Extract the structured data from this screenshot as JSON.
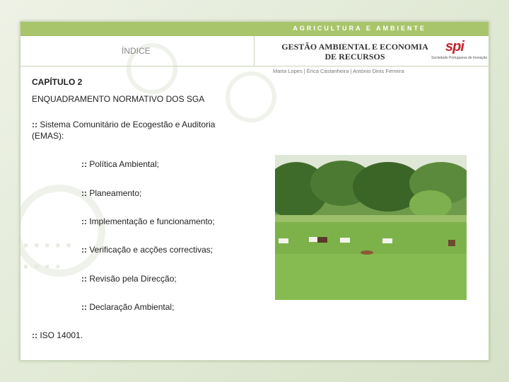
{
  "header": {
    "topbar_text": "AGRICULTURA E AMBIENTE",
    "index_label": "ÍNDICE",
    "book_title_line1": "GESTÃO AMBIENTAL E ECONOMIA",
    "book_title_line2": "DE RECURSOS",
    "logo_mark": "spi",
    "logo_text": "Sociedade Portuguesa de Inovação",
    "authors": "Marta Lopes | Érica Castanheira | António Dinis Ferreira"
  },
  "content": {
    "chapter": "CAPÍTULO 2",
    "subtitle": "ENQUADRAMENTO NORMATIVO DOS SGA",
    "bullet": "::",
    "emas_line1": "Sistema Comunitário de Ecogestão e Auditoria",
    "emas_line2": "(EMAS):",
    "sub_items": [
      "Política Ambiental;",
      "Planeamento;",
      "Implementação e funcionamento;",
      "Verificação e acções correctivas;",
      "Revisão pela Direcção;",
      "Declaração Ambiental;"
    ],
    "iso": "ISO 14001."
  },
  "colors": {
    "topbar": "#a9c56b",
    "logo_red": "#c0262d"
  }
}
